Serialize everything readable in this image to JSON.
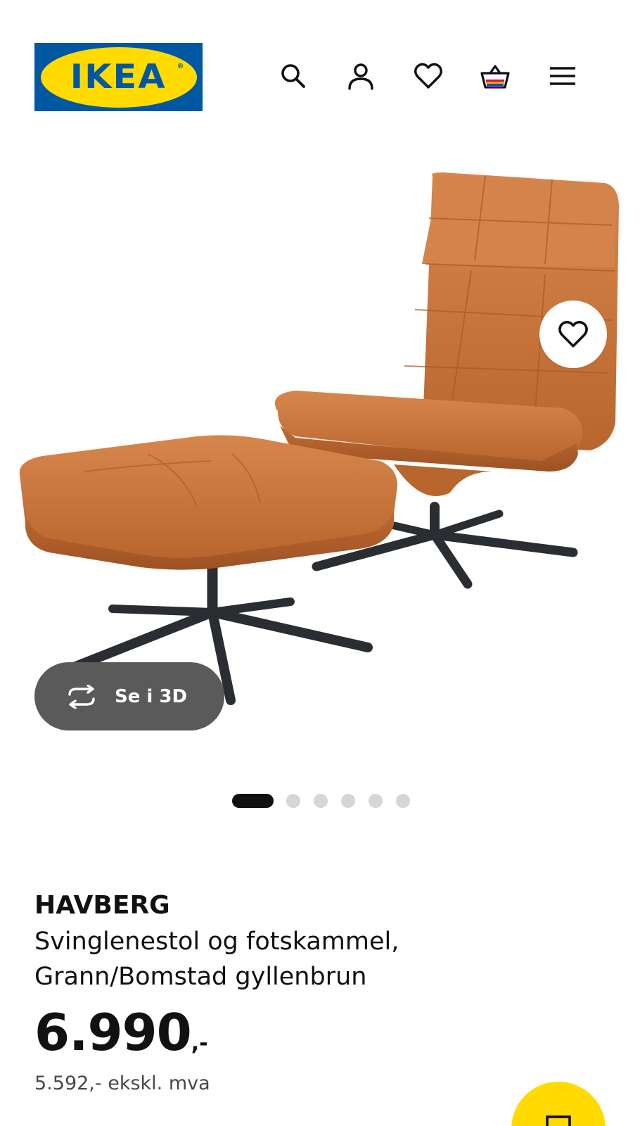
{
  "header": {
    "logo_text": "IKEA",
    "logo_reg": "®",
    "icons": [
      "search-icon",
      "account-icon",
      "heart-icon",
      "basket-icon",
      "menu-icon"
    ]
  },
  "gallery": {
    "view_3d_label": "Se i 3D",
    "total_images": 6,
    "active_index": 0
  },
  "product": {
    "name": "HAVBERG",
    "description_line1": "Svinglenestol og fotskammel,",
    "description_line2": "Grann/Bomstad gyllenbrun",
    "price": "6.990",
    "price_suffix": ",-",
    "price_ex_vat": "5.592,- ekskl. mva"
  },
  "colors": {
    "ikea_blue": "#0058a3",
    "ikea_yellow": "#ffdb00",
    "leather": "#c8743c",
    "text": "#111111"
  }
}
